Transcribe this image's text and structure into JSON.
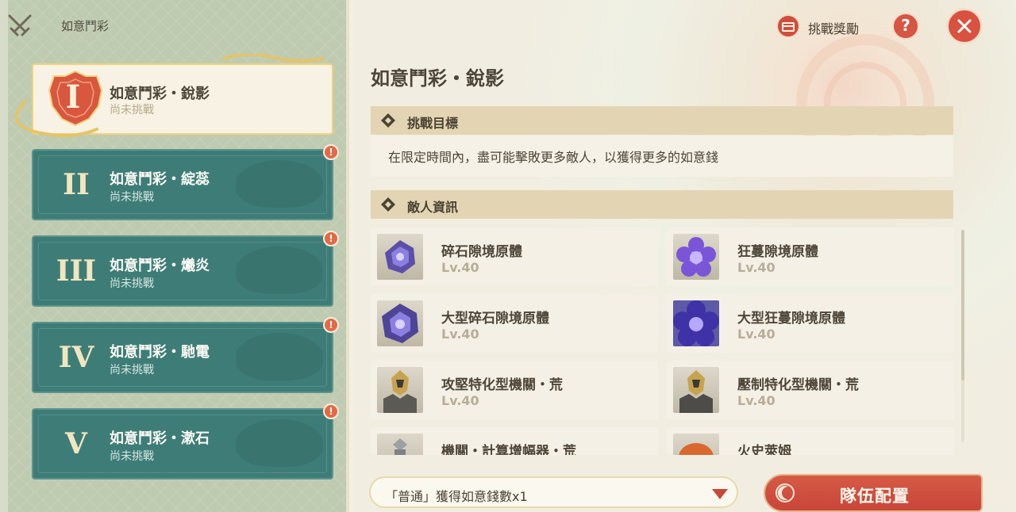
{
  "left_panel": {
    "title": "如意鬥彩",
    "cards": [
      {
        "numeral": "I",
        "title": "如意鬥彩・銳影",
        "status": "尚未挑戰",
        "selected": true,
        "alert": false
      },
      {
        "numeral": "II",
        "title": "如意鬥彩・綻蕊",
        "status": "尚未挑戰",
        "selected": false,
        "alert": true
      },
      {
        "numeral": "III",
        "title": "如意鬥彩・爔炎",
        "status": "尚未挑戰",
        "selected": false,
        "alert": true
      },
      {
        "numeral": "IV",
        "title": "如意鬥彩・馳電",
        "status": "尚未挑戰",
        "selected": false,
        "alert": true
      },
      {
        "numeral": "V",
        "title": "如意鬥彩・漱石",
        "status": "尚未挑戰",
        "selected": false,
        "alert": true
      }
    ],
    "alert_mark": "!"
  },
  "header": {
    "reward_label": "挑戰獎勵",
    "help_label": "?"
  },
  "main": {
    "title": "如意鬥彩・銳影",
    "objective_header": "挑戰目標",
    "objective_text": "在限定時間內，盡可能擊敗更多敵人，以獲得更多的如意錢",
    "enemy_header": "敵人資訊",
    "enemies": [
      {
        "name": "碎石隙境原體",
        "level": "Lv.40",
        "icon": "purple-crystal-icon"
      },
      {
        "name": "狂蔓隙境原體",
        "level": "Lv.40",
        "icon": "purple-flower-icon"
      },
      {
        "name": "大型碎石隙境原體",
        "level": "Lv.40",
        "icon": "purple-crystal-icon"
      },
      {
        "name": "大型狂蔓隙境原體",
        "level": "Lv.40",
        "icon": "purple-flower-icon"
      },
      {
        "name": "攻堅特化型機關・荒",
        "level": "Lv.40",
        "icon": "mech-icon"
      },
      {
        "name": "壓制特化型機關・荒",
        "level": "Lv.40",
        "icon": "mech-icon"
      },
      {
        "name": "機關・計算增幅器・荒",
        "level": "",
        "icon": "mech-icon"
      },
      {
        "name": "火史萊姆",
        "level": "",
        "icon": "slime-icon"
      }
    ]
  },
  "footer": {
    "reward_select_value": "「普通」獲得如意錢數x1",
    "team_button_label": "隊伍配置"
  },
  "colors": {
    "teal_card": "#3e7d77",
    "accent_red": "#d65a45",
    "gold": "#e3c66a",
    "section_header": "#e3d5b4"
  }
}
